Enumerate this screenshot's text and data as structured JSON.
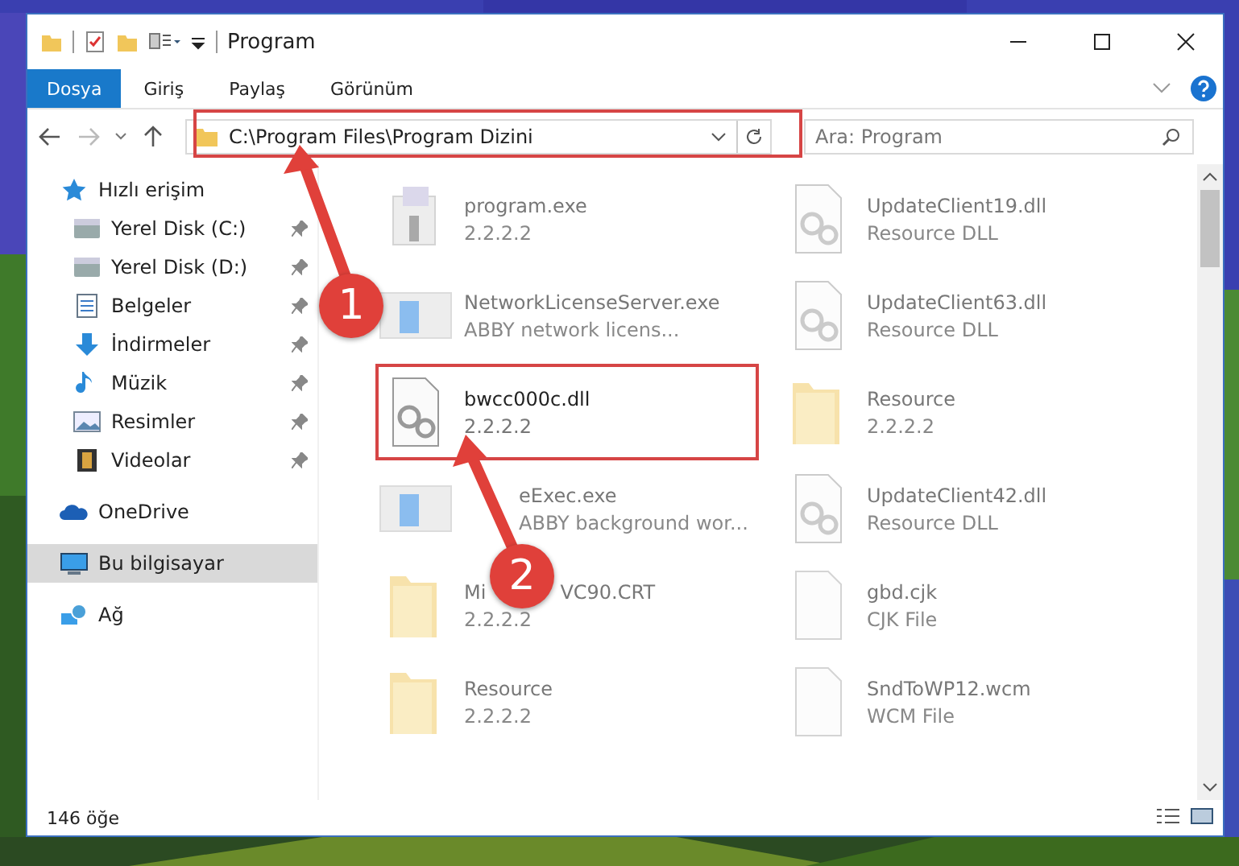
{
  "window": {
    "title": "Program"
  },
  "ribbon_tabs": [
    {
      "label": "Dosya",
      "selected": true
    },
    {
      "label": "Giriş",
      "selected": false
    },
    {
      "label": "Paylaş",
      "selected": false
    },
    {
      "label": "Görünüm",
      "selected": false
    }
  ],
  "address": {
    "path": "C:\\Program Files\\Program Dizini"
  },
  "search": {
    "placeholder": "Ara: Program"
  },
  "sidebar": {
    "items": [
      {
        "label": "Hızlı erişim",
        "kind": "star",
        "selected": false,
        "children": [
          {
            "label": "Yerel Disk (C:)",
            "kind": "drive",
            "pinned": true,
            "selected": false
          },
          {
            "label": "Yerel Disk (D:)",
            "kind": "drive",
            "pinned": true,
            "selected": false
          },
          {
            "label": "Belgeler",
            "kind": "document",
            "pinned": true,
            "selected": false
          },
          {
            "label": "İndirmeler",
            "kind": "download",
            "pinned": true,
            "selected": false
          },
          {
            "label": "Müzik",
            "kind": "music",
            "pinned": true,
            "selected": false
          },
          {
            "label": "Resimler",
            "kind": "pictures",
            "pinned": true,
            "selected": false
          },
          {
            "label": "Videolar",
            "kind": "video",
            "pinned": true,
            "selected": false
          }
        ]
      },
      {
        "label": "OneDrive",
        "kind": "cloud",
        "selected": false
      },
      {
        "label": "Bu bilgisayar",
        "kind": "computer",
        "selected": true
      },
      {
        "label": "Ağ",
        "kind": "network",
        "selected": false
      }
    ]
  },
  "files": [
    {
      "name": "program.exe",
      "detail": "2.2.2.2",
      "kind": "exe",
      "highlighted": false
    },
    {
      "name": "UpdateClient19.dll",
      "detail": "Resource DLL",
      "kind": "dll",
      "highlighted": false
    },
    {
      "name": "NetworkLicenseServer.exe",
      "detail": "ABBY network licens...",
      "kind": "app",
      "highlighted": false
    },
    {
      "name": "UpdateClient63.dll",
      "detail": "Resource DLL",
      "kind": "dll",
      "highlighted": false
    },
    {
      "name": "bwcc000c.dll",
      "detail": "2.2.2.2",
      "kind": "dll",
      "highlighted": true
    },
    {
      "name": "Resource",
      "detail": "2.2.2.2",
      "kind": "folder",
      "highlighted": false
    },
    {
      "name": "eExec.exe",
      "detail": "ABBY background wor...",
      "kind": "app",
      "highlighted": false
    },
    {
      "name": "UpdateClient42.dll",
      "detail": "Resource DLL",
      "kind": "dll",
      "highlighted": false
    },
    {
      "name": "Mi",
      "name_rest": "VC90.CRT",
      "detail": "2.2.2.2",
      "kind": "folder",
      "highlighted": false
    },
    {
      "name": "gbd.cjk",
      "detail": "CJK File",
      "kind": "file",
      "highlighted": false
    },
    {
      "name": "Resource",
      "detail": "2.2.2.2",
      "kind": "folder",
      "highlighted": false
    },
    {
      "name": "SndToWP12.wcm",
      "detail": "WCM File",
      "kind": "file",
      "highlighted": false
    }
  ],
  "status_bar": {
    "count": "146 öğe"
  },
  "annotations": [
    {
      "number": "1"
    },
    {
      "number": "2"
    }
  ]
}
